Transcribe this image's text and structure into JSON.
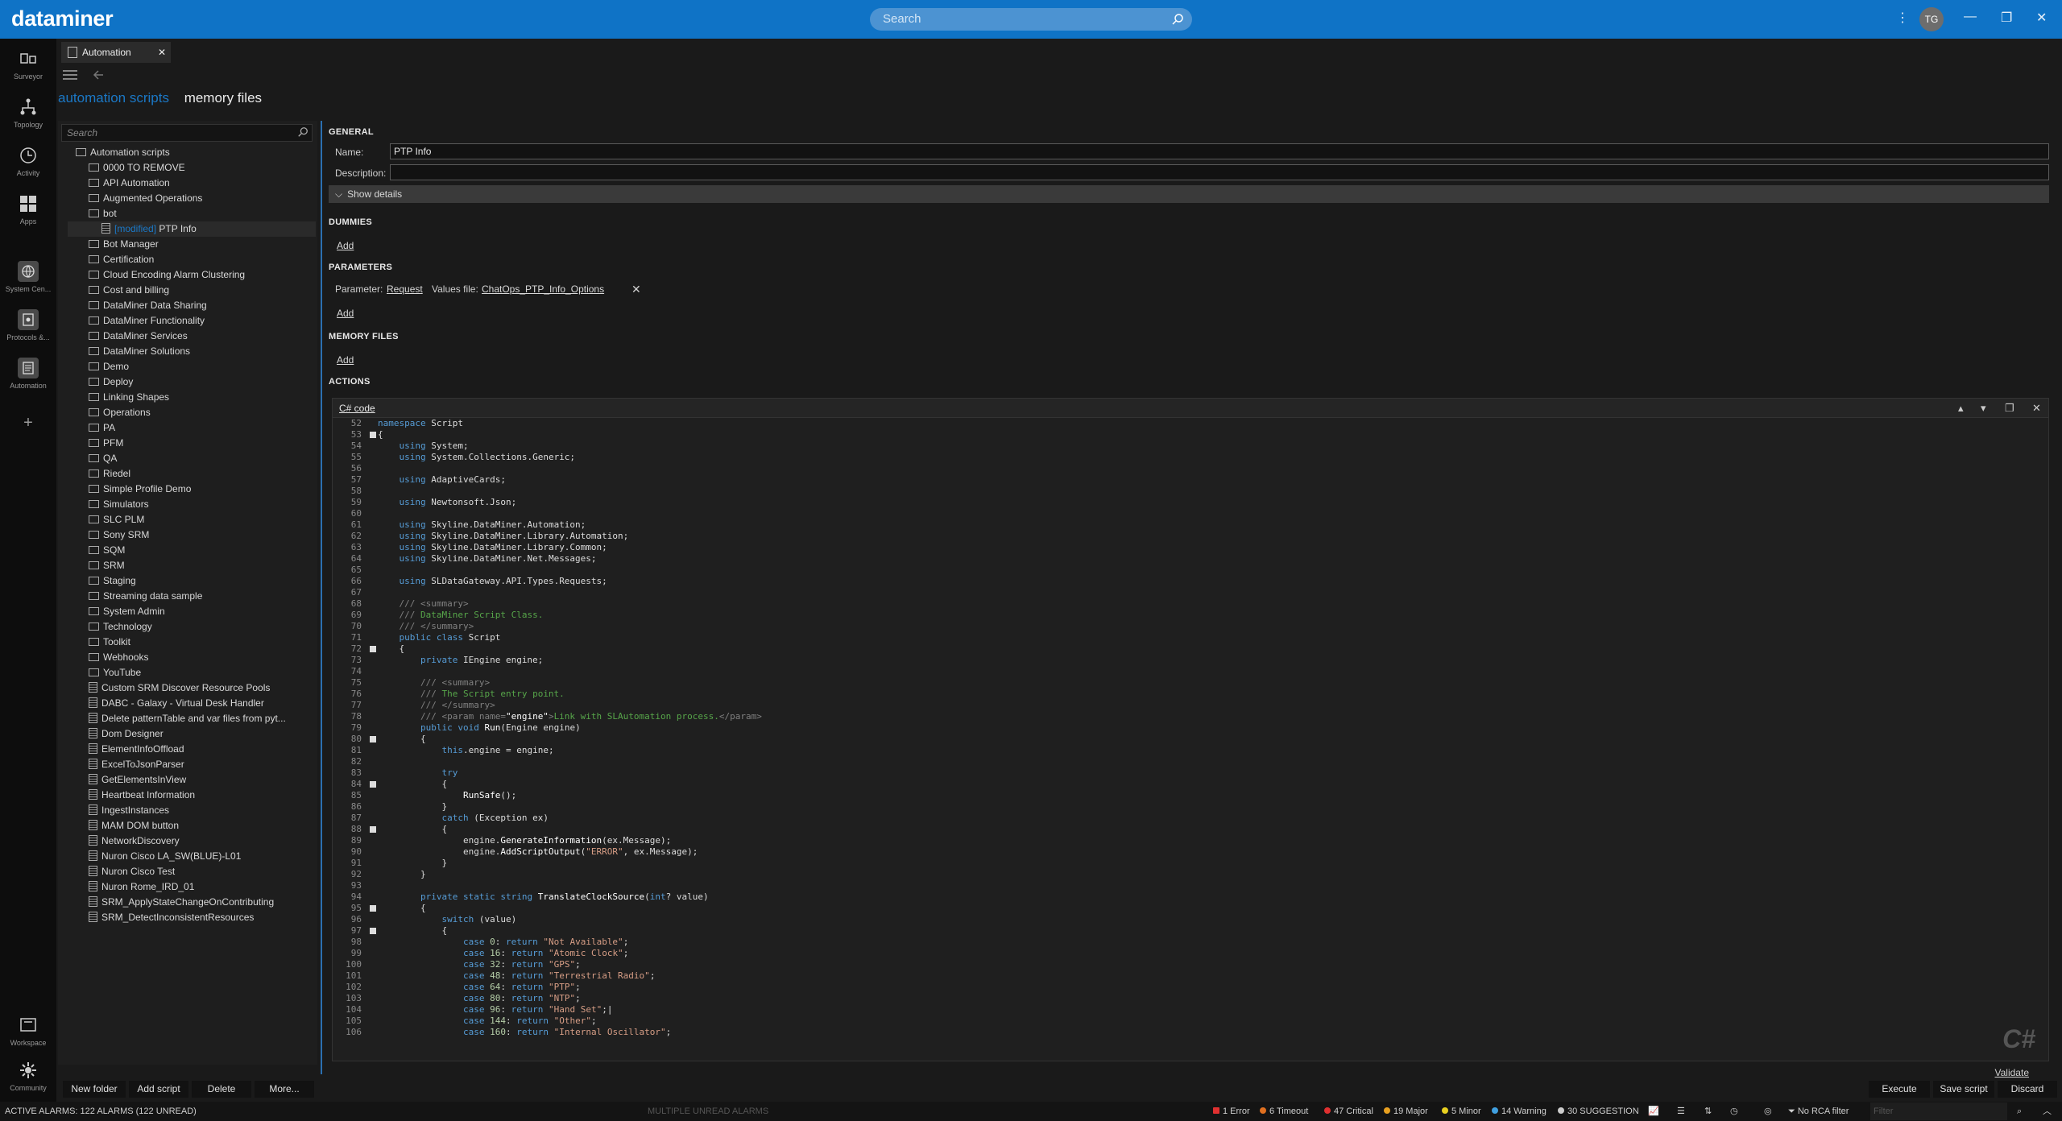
{
  "app": {
    "logo": "dataminer",
    "search_placeholder": "Search",
    "user_initials": "TG"
  },
  "nav": {
    "top": [
      {
        "label": "Surveyor"
      },
      {
        "label": "Topology"
      },
      {
        "label": "Activity"
      },
      {
        "label": "Apps"
      },
      {
        "label": "System Cen..."
      },
      {
        "label": "Protocols &..."
      },
      {
        "label": "Automation"
      },
      {
        "label": "+"
      }
    ],
    "bottom": [
      {
        "label": "Workspace"
      },
      {
        "label": "Community"
      }
    ]
  },
  "tab": {
    "label": "Automation"
  },
  "subtabs": {
    "scripts": "automation scripts",
    "memory": "memory files"
  },
  "tree": {
    "search_placeholder": "Search",
    "root": "Automation scripts",
    "modified_tag": "[modified]",
    "folders": [
      "0000 TO REMOVE",
      "API Automation",
      "Augmented Operations",
      "bot"
    ],
    "selected_script": "PTP Info",
    "folders2": [
      "Bot Manager",
      "Certification",
      "Cloud Encoding Alarm Clustering",
      "Cost and billing",
      "DataMiner Data Sharing",
      "DataMiner Functionality",
      "DataMiner Services",
      "DataMiner Solutions",
      "Demo",
      "Deploy",
      "Linking Shapes",
      "Operations",
      "PA",
      "PFM",
      "QA",
      "Riedel",
      "Simple Profile Demo",
      "Simulators",
      "SLC PLM",
      "Sony SRM",
      "SQM",
      "SRM",
      "Staging",
      "Streaming data sample",
      "System Admin",
      "Technology",
      "Toolkit",
      "Webhooks",
      "YouTube"
    ],
    "scripts": [
      "Custom SRM Discover Resource Pools",
      "DABC - Galaxy - Virtual Desk Handler",
      "Delete patternTable and var files from pyt...",
      "Dom Designer",
      "ElementInfoOffload",
      "ExcelToJsonParser",
      "GetElementsInView",
      "Heartbeat Information",
      "IngestInstances",
      "MAM DOM button",
      "NetworkDiscovery",
      "Nuron Cisco LA_SW(BLUE)-L01",
      "Nuron Cisco Test",
      "Nuron Rome_IRD_01",
      "SRM_ApplyStateChangeOnContributing",
      "SRM_DetectInconsistentResources"
    ]
  },
  "tree_buttons": {
    "new_folder": "New folder",
    "add_script": "Add script",
    "delete": "Delete",
    "more": "More..."
  },
  "general": {
    "heading": "GENERAL",
    "name_label": "Name:",
    "name_value": "PTP Info",
    "desc_label": "Description:",
    "desc_value": "",
    "show_details": "Show details"
  },
  "dummies": {
    "heading": "DUMMIES",
    "add": "Add"
  },
  "parameters": {
    "heading": "PARAMETERS",
    "param_label": "Parameter:",
    "param_value": "Request",
    "values_label": "Values file:",
    "values_value": "ChatOps_PTP_Info_Options",
    "add": "Add"
  },
  "memory_files": {
    "heading": "MEMORY FILES",
    "add": "Add"
  },
  "actions": {
    "heading": "ACTIONS",
    "code_title": "C# code",
    "language_mark": "C#",
    "validate": "Validate"
  },
  "code_lines": [
    {
      "n": "52",
      "h": "<span class='k'>namespace</span> Script"
    },
    {
      "n": "53",
      "h": "{",
      "fold": true
    },
    {
      "n": "54",
      "h": "    <span class='k'>using</span> System;"
    },
    {
      "n": "55",
      "h": "    <span class='k'>using</span> System.Collections.Generic;"
    },
    {
      "n": "56",
      "h": ""
    },
    {
      "n": "57",
      "h": "    <span class='k'>using</span> AdaptiveCards;"
    },
    {
      "n": "58",
      "h": ""
    },
    {
      "n": "59",
      "h": "    <span class='k'>using</span> Newtonsoft.Json;"
    },
    {
      "n": "60",
      "h": ""
    },
    {
      "n": "61",
      "h": "    <span class='k'>using</span> Skyline.DataMiner.Automation;"
    },
    {
      "n": "62",
      "h": "    <span class='k'>using</span> Skyline.DataMiner.Library.Automation;"
    },
    {
      "n": "63",
      "h": "    <span class='k'>using</span> Skyline.DataMiner.Library.Common;"
    },
    {
      "n": "64",
      "h": "    <span class='k'>using</span> Skyline.DataMiner.Net.Messages;"
    },
    {
      "n": "65",
      "h": ""
    },
    {
      "n": "66",
      "h": "    <span class='k'>using</span> SLDataGateway.API.Types.Requests;"
    },
    {
      "n": "67",
      "h": ""
    },
    {
      "n": "68",
      "h": "    <span class='dc'>///</span> <span class='dc'>&lt;summary&gt;</span>"
    },
    {
      "n": "69",
      "h": "    <span class='dc'>///</span> <span class='c'>DataMiner Script Class.</span>"
    },
    {
      "n": "70",
      "h": "    <span class='dc'>/// &lt;/summary&gt;</span>"
    },
    {
      "n": "71",
      "h": "    <span class='k'>public</span> <span class='k'>class</span> Script"
    },
    {
      "n": "72",
      "h": "    {",
      "fold": true
    },
    {
      "n": "73",
      "h": "        <span class='k'>private</span> IEngine engine;"
    },
    {
      "n": "74",
      "h": ""
    },
    {
      "n": "75",
      "h": "        <span class='dc'>/// &lt;summary&gt;</span>"
    },
    {
      "n": "76",
      "h": "        <span class='dc'>///</span> <span class='c'>The Script entry point.</span>"
    },
    {
      "n": "77",
      "h": "        <span class='dc'>/// &lt;/summary&gt;</span>"
    },
    {
      "n": "78",
      "h": "        <span class='dc'>/// &lt;param name=</span><span class='m'>\"engine\"</span><span class='dc'>&gt;</span><span class='c'>Link with SLAutomation process.</span><span class='dc'>&lt;/param&gt;</span>"
    },
    {
      "n": "79",
      "h": "        <span class='k'>public</span> <span class='k'>void</span> <span class='m'>Run</span>(Engine engine)"
    },
    {
      "n": "80",
      "h": "        {",
      "fold": true
    },
    {
      "n": "81",
      "h": "            <span class='k'>this</span>.engine = engine;"
    },
    {
      "n": "82",
      "h": ""
    },
    {
      "n": "83",
      "h": "            <span class='k'>try</span>"
    },
    {
      "n": "84",
      "h": "            {",
      "fold": true
    },
    {
      "n": "85",
      "h": "                <span class='m'>RunSafe</span>();"
    },
    {
      "n": "86",
      "h": "            }"
    },
    {
      "n": "87",
      "h": "            <span class='k'>catch</span> (Exception ex)"
    },
    {
      "n": "88",
      "h": "            {",
      "fold": true
    },
    {
      "n": "89",
      "h": "                engine.<span class='m'>GenerateInformation</span>(ex.Message);"
    },
    {
      "n": "90",
      "h": "                engine.<span class='m'>AddScriptOutput</span>(<span class='s'>\"ERROR\"</span>, ex.Message);"
    },
    {
      "n": "91",
      "h": "            }"
    },
    {
      "n": "92",
      "h": "        }"
    },
    {
      "n": "93",
      "h": ""
    },
    {
      "n": "94",
      "h": "        <span class='k'>private</span> <span class='k'>static</span> <span class='k'>string</span> <span class='m'>TranslateClockSource</span>(<span class='k'>int</span>? value)"
    },
    {
      "n": "95",
      "h": "        {",
      "fold": true
    },
    {
      "n": "96",
      "h": "            <span class='k'>switch</span> (value)"
    },
    {
      "n": "97",
      "h": "            {",
      "fold": true
    },
    {
      "n": "98",
      "h": "                <span class='k'>case</span> <span class='n'>0</span>: <span class='k'>return</span> <span class='s'>\"Not Available\"</span>;"
    },
    {
      "n": "99",
      "h": "                <span class='k'>case</span> <span class='n'>16</span>: <span class='k'>return</span> <span class='s'>\"Atomic Clock\"</span>;"
    },
    {
      "n": "100",
      "h": "                <span class='k'>case</span> <span class='n'>32</span>: <span class='k'>return</span> <span class='s'>\"GPS\"</span>;"
    },
    {
      "n": "101",
      "h": "                <span class='k'>case</span> <span class='n'>48</span>: <span class='k'>return</span> <span class='s'>\"Terrestrial Radio\"</span>;"
    },
    {
      "n": "102",
      "h": "                <span class='k'>case</span> <span class='n'>64</span>: <span class='k'>return</span> <span class='s'>\"PTP\"</span>;"
    },
    {
      "n": "103",
      "h": "                <span class='k'>case</span> <span class='n'>80</span>: <span class='k'>return</span> <span class='s'>\"NTP\"</span>;"
    },
    {
      "n": "104",
      "h": "                <span class='k'>case</span> <span class='n'>96</span>: <span class='k'>return</span> <span class='s'>\"Hand Set\"</span>;|"
    },
    {
      "n": "105",
      "h": "                <span class='k'>case</span> <span class='n'>144</span>: <span class='k'>return</span> <span class='s'>\"Other\"</span>;"
    },
    {
      "n": "106",
      "h": "                <span class='k'>case</span> <span class='n'>160</span>: <span class='k'>return</span> <span class='s'>\"Internal Oscillator\"</span>;"
    }
  ],
  "footer_buttons": {
    "execute": "Execute",
    "save": "Save script",
    "discard": "Discard"
  },
  "status": {
    "left": "ACTIVE ALARMS: 122 ALARMS (122 UNREAD)",
    "middle": "MULTIPLE UNREAD ALARMS",
    "error": "1 Error",
    "timeout": "6 Timeout",
    "critical": "47 Critical",
    "major": "19 Major",
    "minor": "5 Minor",
    "warning": "14 Warning",
    "suggestion": "30 SUGGESTION",
    "rca": "No RCA filter",
    "filter_placeholder": "Filter",
    "colors": {
      "error": "#e03030",
      "timeout": "#e07020",
      "critical": "#e03030",
      "major": "#e8a020",
      "minor": "#e8d020",
      "warning": "#40a0e0",
      "suggestion": "#cccccc"
    }
  }
}
